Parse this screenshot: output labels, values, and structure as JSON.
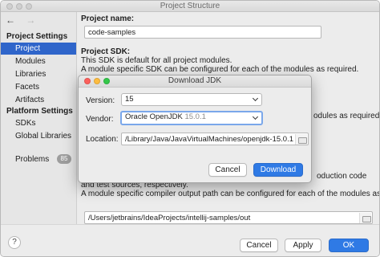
{
  "window": {
    "title": "Project Structure",
    "nav_back": "←",
    "nav_forward": "→"
  },
  "sidebar": {
    "project_settings_header": "Project Settings",
    "project_items": [
      {
        "label": "Project",
        "selected": true
      },
      {
        "label": "Modules",
        "selected": false
      },
      {
        "label": "Libraries",
        "selected": false
      },
      {
        "label": "Facets",
        "selected": false
      },
      {
        "label": "Artifacts",
        "selected": false
      }
    ],
    "platform_settings_header": "Platform Settings",
    "platform_items": [
      {
        "label": "SDKs"
      },
      {
        "label": "Global Libraries"
      }
    ],
    "problems_label": "Problems",
    "problems_count": "85"
  },
  "content": {
    "project_name_label": "Project name:",
    "project_name_value": "code-samples",
    "project_sdk_label": "Project SDK:",
    "sdk_line1": "This SDK is default for all project modules.",
    "sdk_line2": "A module specific SDK can be configured for each of the modules as required.",
    "right_line1": "odules as required.",
    "right_line2": "oduction code",
    "compiler_line1": "and test sources, respectively.",
    "compiler_line2": "A module specific compiler output path can be configured for each of the modules as required.",
    "output_path": "/Users/jetbrains/IdeaProjects/intellij-samples/out"
  },
  "dialog": {
    "title": "Download JDK",
    "version_label": "Version:",
    "version_value": "15",
    "vendor_label": "Vendor:",
    "vendor_name": "Oracle OpenJDK",
    "vendor_version": "15.0.1",
    "location_label": "Location:",
    "location_value": "/Library/Java/JavaVirtualMachines/openjdk-15.0.1",
    "cancel_label": "Cancel",
    "download_label": "Download",
    "traffic_colors": [
      "#fc605c",
      "#fdbc40",
      "#34c84a"
    ]
  },
  "bottom": {
    "help_label": "?",
    "cancel_label": "Cancel",
    "apply_label": "Apply",
    "ok_label": "OK"
  }
}
